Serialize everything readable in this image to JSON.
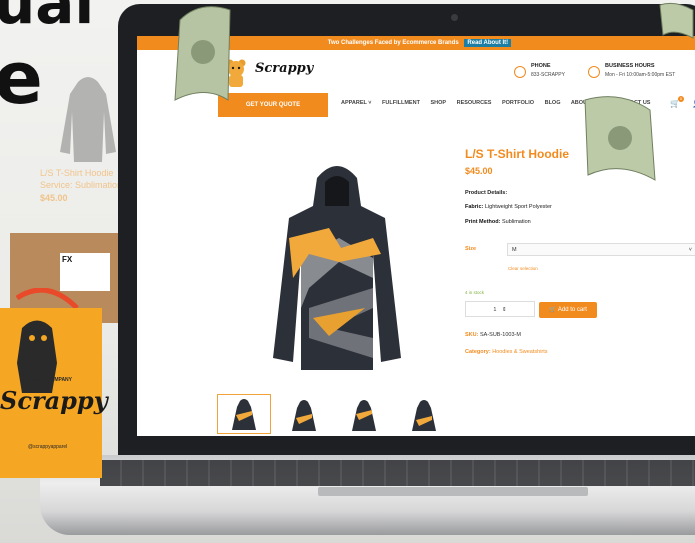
{
  "headline": {
    "line1": "ual",
    "line2": "e"
  },
  "background": {
    "product_name": "L/S T-Shirt Hoodie",
    "subtitle": "Service: Sublimation",
    "price": "$45.00"
  },
  "site": {
    "announcement": "Two Challenges Faced by Ecommerce Brands",
    "read_label": "Read About It!",
    "logo_text": "Scrappy",
    "phone_label": "PHONE",
    "phone_value": "833-SCRAPPY",
    "hours_label": "BUSINESS HOURS",
    "hours_value": "Mon - Fri 10:00am-5:00pm EST",
    "quote_button": "GET YOUR QUOTE",
    "nav": [
      "APPAREL ˅",
      "FULFILLMENT",
      "SHOP",
      "RESOURCES",
      "PORTFOLIO",
      "BLOG",
      "ABOUT US ˅",
      "CONTACT US"
    ],
    "cart_count": "0"
  },
  "product": {
    "title": "L/S T-Shirt Hoodie",
    "price": "$45.00",
    "details_label": "Product Details:",
    "fabric_label": "Fabric:",
    "fabric_value": "Lightweight Sport Polyester",
    "print_label": "Print Method:",
    "print_value": "Sublimation",
    "size_label": "Size",
    "size_value": "M",
    "clear_label": "Clear selection",
    "stock": "4 in stock",
    "quantity": "1",
    "add_to_cart": "Add to cart",
    "sku_label": "SKU:",
    "sku_value": "SA-SUB-1003-M",
    "category_label": "Category:",
    "category_value": "Hoodies & Sweatshirts"
  },
  "bag": {
    "small_text": "APPAREL COMPANY",
    "brand": "Scrappy",
    "handle": "@scrappyapparel"
  },
  "box": {
    "label": "FX"
  },
  "colors": {
    "accent": "#f28b1e",
    "laptop": "#1e1f22"
  }
}
